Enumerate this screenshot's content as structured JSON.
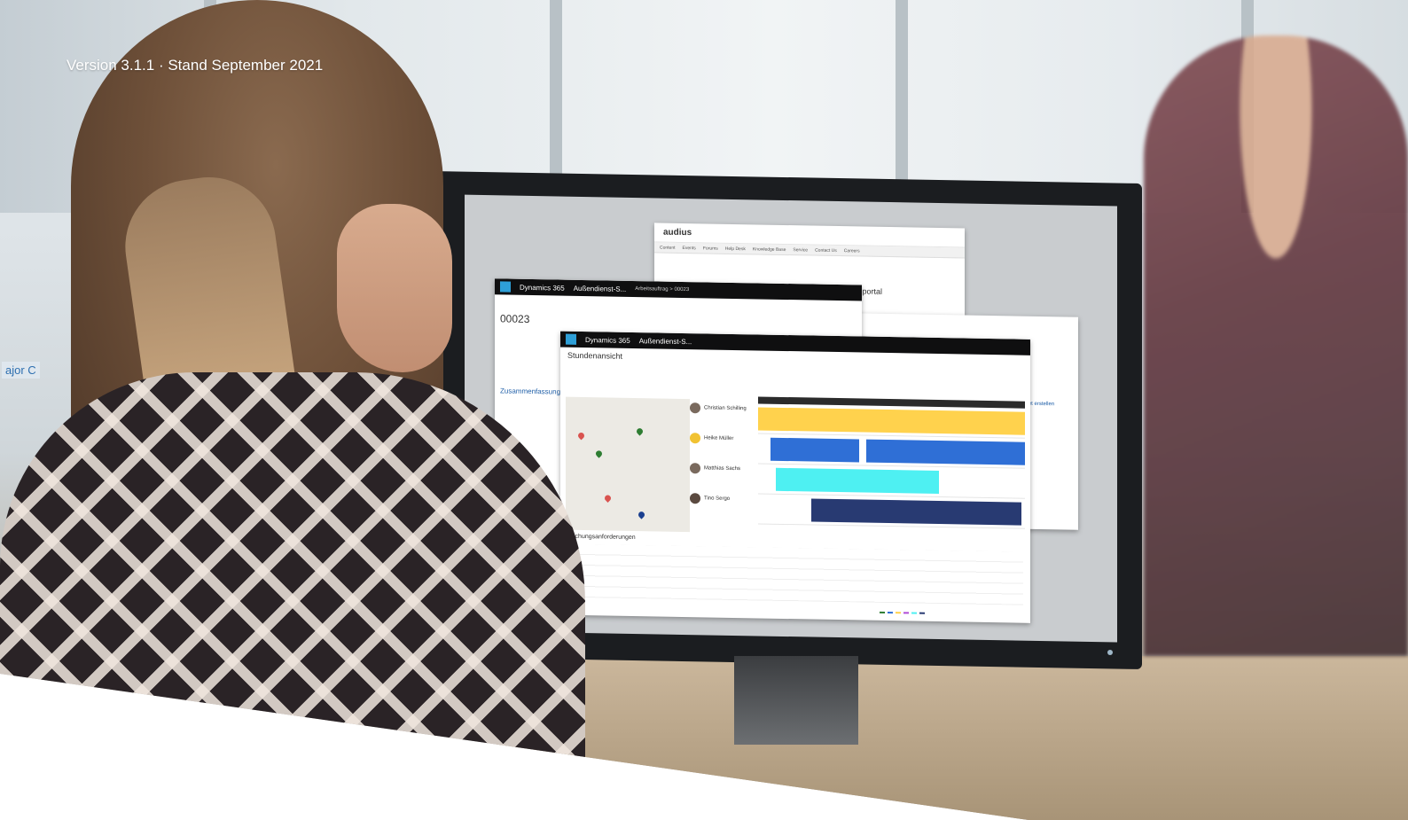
{
  "caption": "Version 3.1.1 · Stand September 2021",
  "background_label": "ajor C",
  "screen": {
    "portal_window": {
      "brand": "audius",
      "nav": [
        "Content",
        "Events",
        "Forums",
        "Help Desk",
        "Knowledge Base",
        "Service",
        "Contact Us",
        "Careers"
      ],
      "headline": "Willkommen im Kundenportal",
      "ticket_link": "+ Ticket erstellen"
    },
    "work_order_window": {
      "app": "Dynamics 365",
      "module": "Außendienst-S...",
      "breadcrumb": "Arbeitsauftrag > 00023",
      "record": "00023",
      "section": "Zusammenfassung"
    },
    "schedule_window": {
      "app": "Dynamics 365",
      "module": "Außendienst-S...",
      "view_title": "Stundenansicht",
      "resources": [
        {
          "name": "Christian Schilling"
        },
        {
          "name": "Heike Müller"
        },
        {
          "name": "Matthias Sachs"
        },
        {
          "name": "Tino Sergo"
        }
      ],
      "bottom_title": "Buchungsanforderungen"
    }
  },
  "colors": {
    "dynamics_blue": "#2e9fd7",
    "booking_yellow": "#ffd24d",
    "booking_blue": "#2f6fd6",
    "booking_cyan": "#4ef0f2",
    "booking_navy": "#283a72"
  }
}
